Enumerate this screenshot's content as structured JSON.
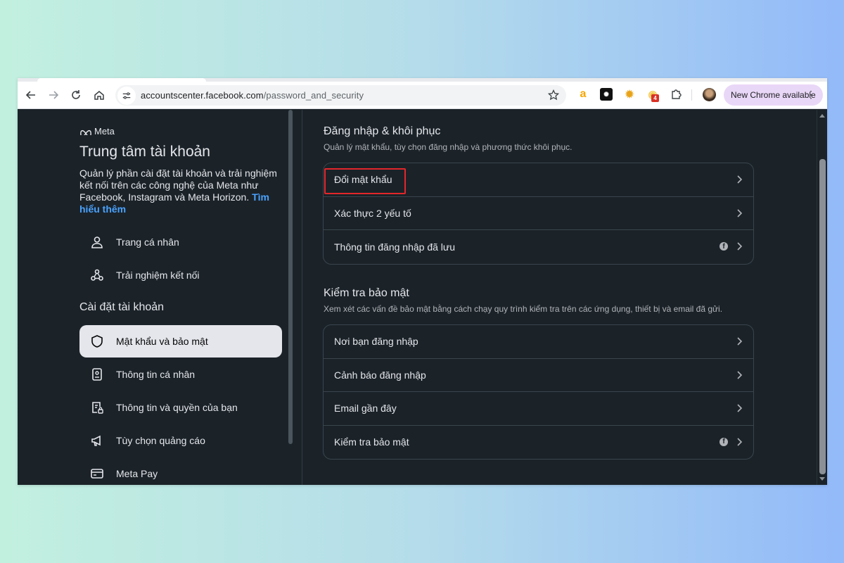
{
  "browser": {
    "url_host": "accountscenter.facebook.com",
    "url_path": "/password_and_security",
    "new_chrome_label": "New Chrome available",
    "extension_badge": "4"
  },
  "sidebar": {
    "logo_text": "Meta",
    "title": "Trung tâm tài khoản",
    "description": "Quản lý phần cài đặt tài khoản và trải nghiệm kết nối trên các công nghệ của Meta như Facebook, Instagram và Meta Horizon. ",
    "learn_more": "Tìm hiểu thêm",
    "top_items": [
      {
        "label": "Trang cá nhân",
        "icon": "person-icon"
      },
      {
        "label": "Trải nghiệm kết nối",
        "icon": "connected-icon"
      }
    ],
    "section_label": "Cài đặt tài khoản",
    "settings_items": [
      {
        "label": "Mật khẩu và bảo mật",
        "icon": "shield-icon",
        "active": true
      },
      {
        "label": "Thông tin cá nhân",
        "icon": "id-card-icon"
      },
      {
        "label": "Thông tin và quyền của bạn",
        "icon": "document-lock-icon"
      },
      {
        "label": "Tùy chọn quảng cáo",
        "icon": "megaphone-icon"
      },
      {
        "label": "Meta Pay",
        "icon": "credit-card-icon"
      }
    ]
  },
  "main": {
    "login_section": {
      "title": "Đăng nhập & khôi phục",
      "subtitle": "Quản lý mật khẩu, tùy chọn đăng nhập và phương thức khôi phục.",
      "items": [
        "Đổi mật khẩu",
        "Xác thực 2 yếu tố",
        "Thông tin đăng nhập đã lưu"
      ]
    },
    "security_section": {
      "title": "Kiểm tra bảo mật",
      "subtitle": "Xem xét các vấn đề bảo mật bằng cách chạy quy trình kiểm tra trên các ứng dụng, thiết bị và email đã gửi.",
      "items": [
        "Nơi bạn đăng nhập",
        "Cảnh báo đăng nhập",
        "Email gần đây",
        "Kiểm tra bảo mật"
      ]
    }
  },
  "colors": {
    "page_bg": "#1b2329",
    "active_item_bg": "#e4e6eb",
    "link": "#4aa2ff",
    "highlight": "#e3262b"
  }
}
